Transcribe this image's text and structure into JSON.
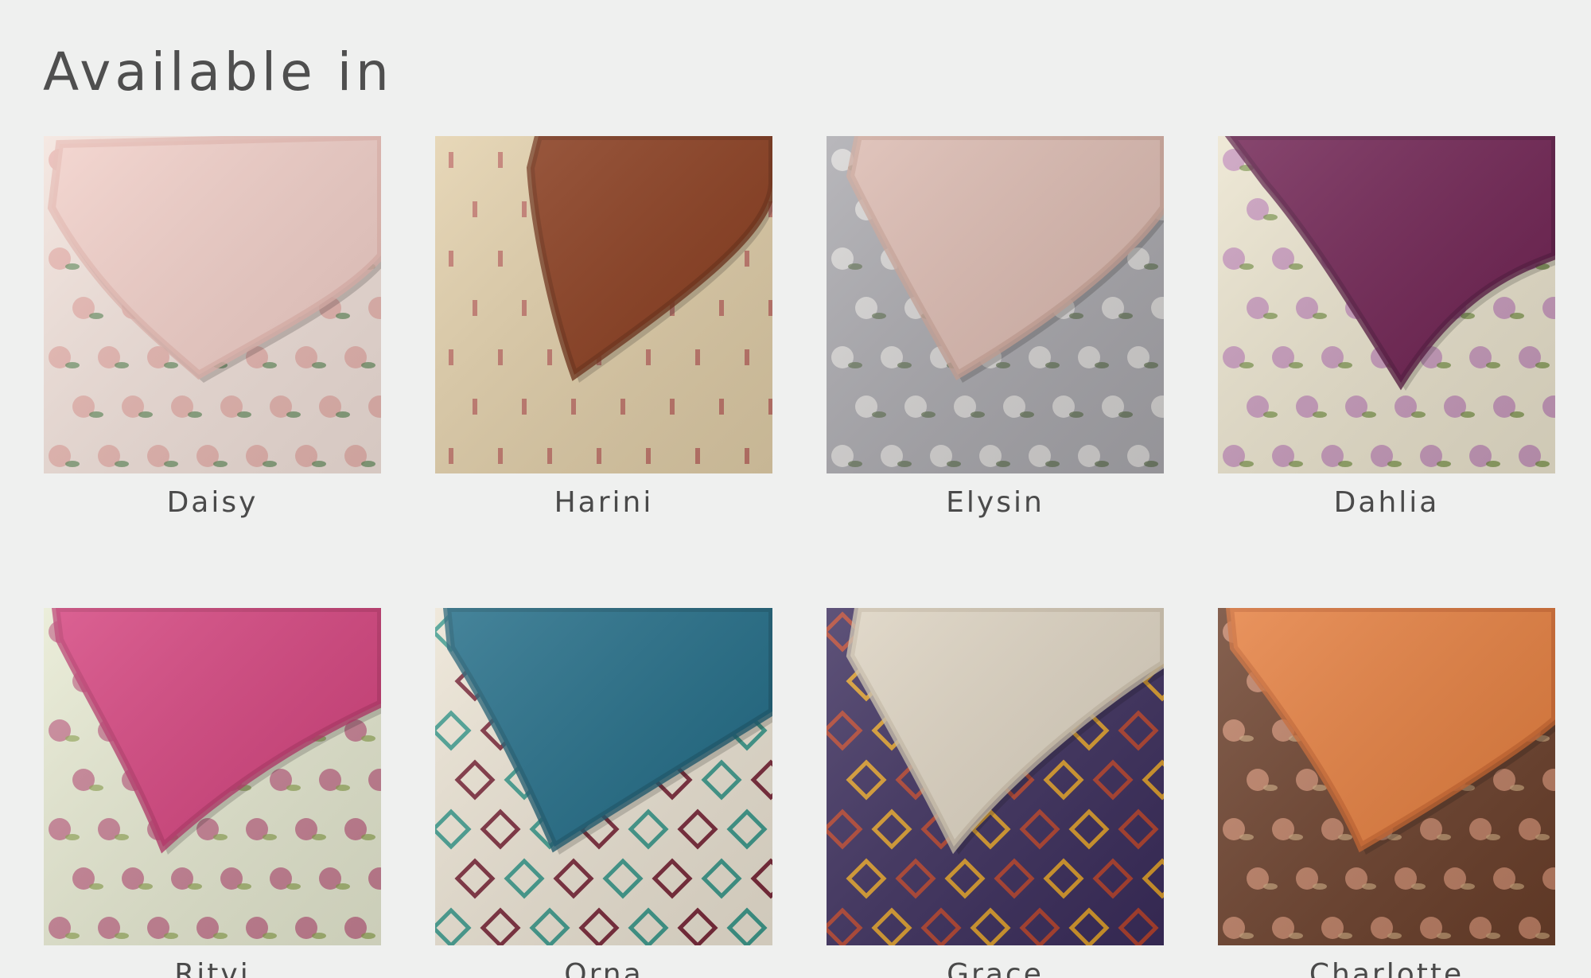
{
  "heading": "Available in",
  "variants": [
    {
      "name": "Daisy",
      "sheet": "#f3e3dc",
      "pillow": "#f2cfc8",
      "pillow_shade": "#e6b8b0",
      "accent": "#e39b96",
      "leaf": "#5f8a5a",
      "icon": "floral-swatch-icon"
    },
    {
      "name": "Harini",
      "sheet": "#e2cfa9",
      "pillow": "#8a3b1c",
      "pillow_shade": "#6f2e14",
      "accent": "#a8323a",
      "leaf": "#5e7a52",
      "icon": "ethnic-swatch-icon"
    },
    {
      "name": "Elysin",
      "sheet": "#a9a8ad",
      "pillow": "#dcbab0",
      "pillow_shade": "#c9a396",
      "accent": "#f7f3ef",
      "leaf": "#5c6d4d",
      "icon": "blossom-swatch-icon"
    },
    {
      "name": "Dahlia",
      "sheet": "#ebe4ce",
      "pillow": "#6e1f50",
      "pillow_shade": "#561740",
      "accent": "#b06bb0",
      "leaf": "#6e8a3c",
      "icon": "lily-swatch-icon"
    },
    {
      "name": "Ritvi",
      "sheet": "#e7ead2",
      "pillow": "#d4407c",
      "pillow_shade": "#b63267",
      "accent": "#b23a6a",
      "leaf": "#8da34e",
      "icon": "peacock-swatch-icon"
    },
    {
      "name": "Orna",
      "sheet": "#ece4d4",
      "pillow": "#1e6a85",
      "pillow_shade": "#15566c",
      "accent": "#7a2a3a",
      "leaf": "#3f9a8c",
      "icon": "geometric-swatch-icon"
    },
    {
      "name": "Grace",
      "sheet": "#3b2d5c",
      "pillow": "#ddd3c1",
      "pillow_shade": "#c8bca6",
      "accent": "#d89a2b",
      "leaf": "#b0422f",
      "icon": "aztec-swatch-icon"
    },
    {
      "name": "Charlotte",
      "sheet": "#6b3f2a",
      "pillow": "#e57d3c",
      "pillow_shade": "#c9632a",
      "accent": "#f2a98a",
      "leaf": "#c9a57a",
      "icon": "rose-swatch-icon"
    }
  ]
}
